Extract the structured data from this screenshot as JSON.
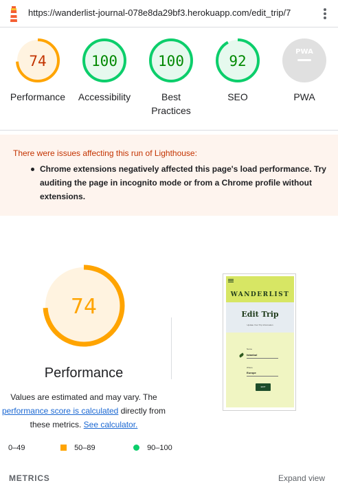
{
  "url_bar": {
    "url": "https://wanderlist-journal-078e8da29bf3.herokuapp.com/edit_trip/7"
  },
  "categories": [
    {
      "label": "Performance",
      "score": "74",
      "rating": "average"
    },
    {
      "label": "Accessibility",
      "score": "100",
      "rating": "pass"
    },
    {
      "label": "Best Practices",
      "score": "100",
      "rating": "pass"
    },
    {
      "label": "SEO",
      "score": "92",
      "rating": "pass"
    },
    {
      "label": "PWA",
      "badge": "PWA",
      "rating": "na"
    }
  ],
  "warning": {
    "title": "There were issues affecting this run of Lighthouse:",
    "items": [
      "Chrome extensions negatively affected this page's load performance. Try auditing the page in incognito mode or from a Chrome profile without extensions."
    ]
  },
  "performance": {
    "score": "74",
    "title": "Performance",
    "note_before": "Values are estimated and may vary. The ",
    "note_link": "performance score is calculated",
    "note_middle": " directly from these metrics. ",
    "calc_link": "See calculator."
  },
  "thumbnail": {
    "brand": "WANDERLIST",
    "heading": "Edit Trip",
    "subheading": "Update Your Trip Information",
    "field1_label": "Name",
    "field1_value": "Istanbul",
    "field2_label": "Where",
    "field2_value": "Europe",
    "button": "EDIT"
  },
  "legend": [
    {
      "range": "0–49",
      "marker": "triangle"
    },
    {
      "range": "50–89",
      "marker": "square"
    },
    {
      "range": "90–100",
      "marker": "circle"
    }
  ],
  "metrics": {
    "title": "METRICS",
    "expand": "Expand view"
  },
  "colors": {
    "pass": "#0cce6b",
    "pass_text": "#008800",
    "average": "#ffa400",
    "average_text": "#c33300",
    "fail": "#ff4e42",
    "na": "#e0e0e0",
    "link": "#1a67d2",
    "warning_bg": "#fef4ee"
  }
}
